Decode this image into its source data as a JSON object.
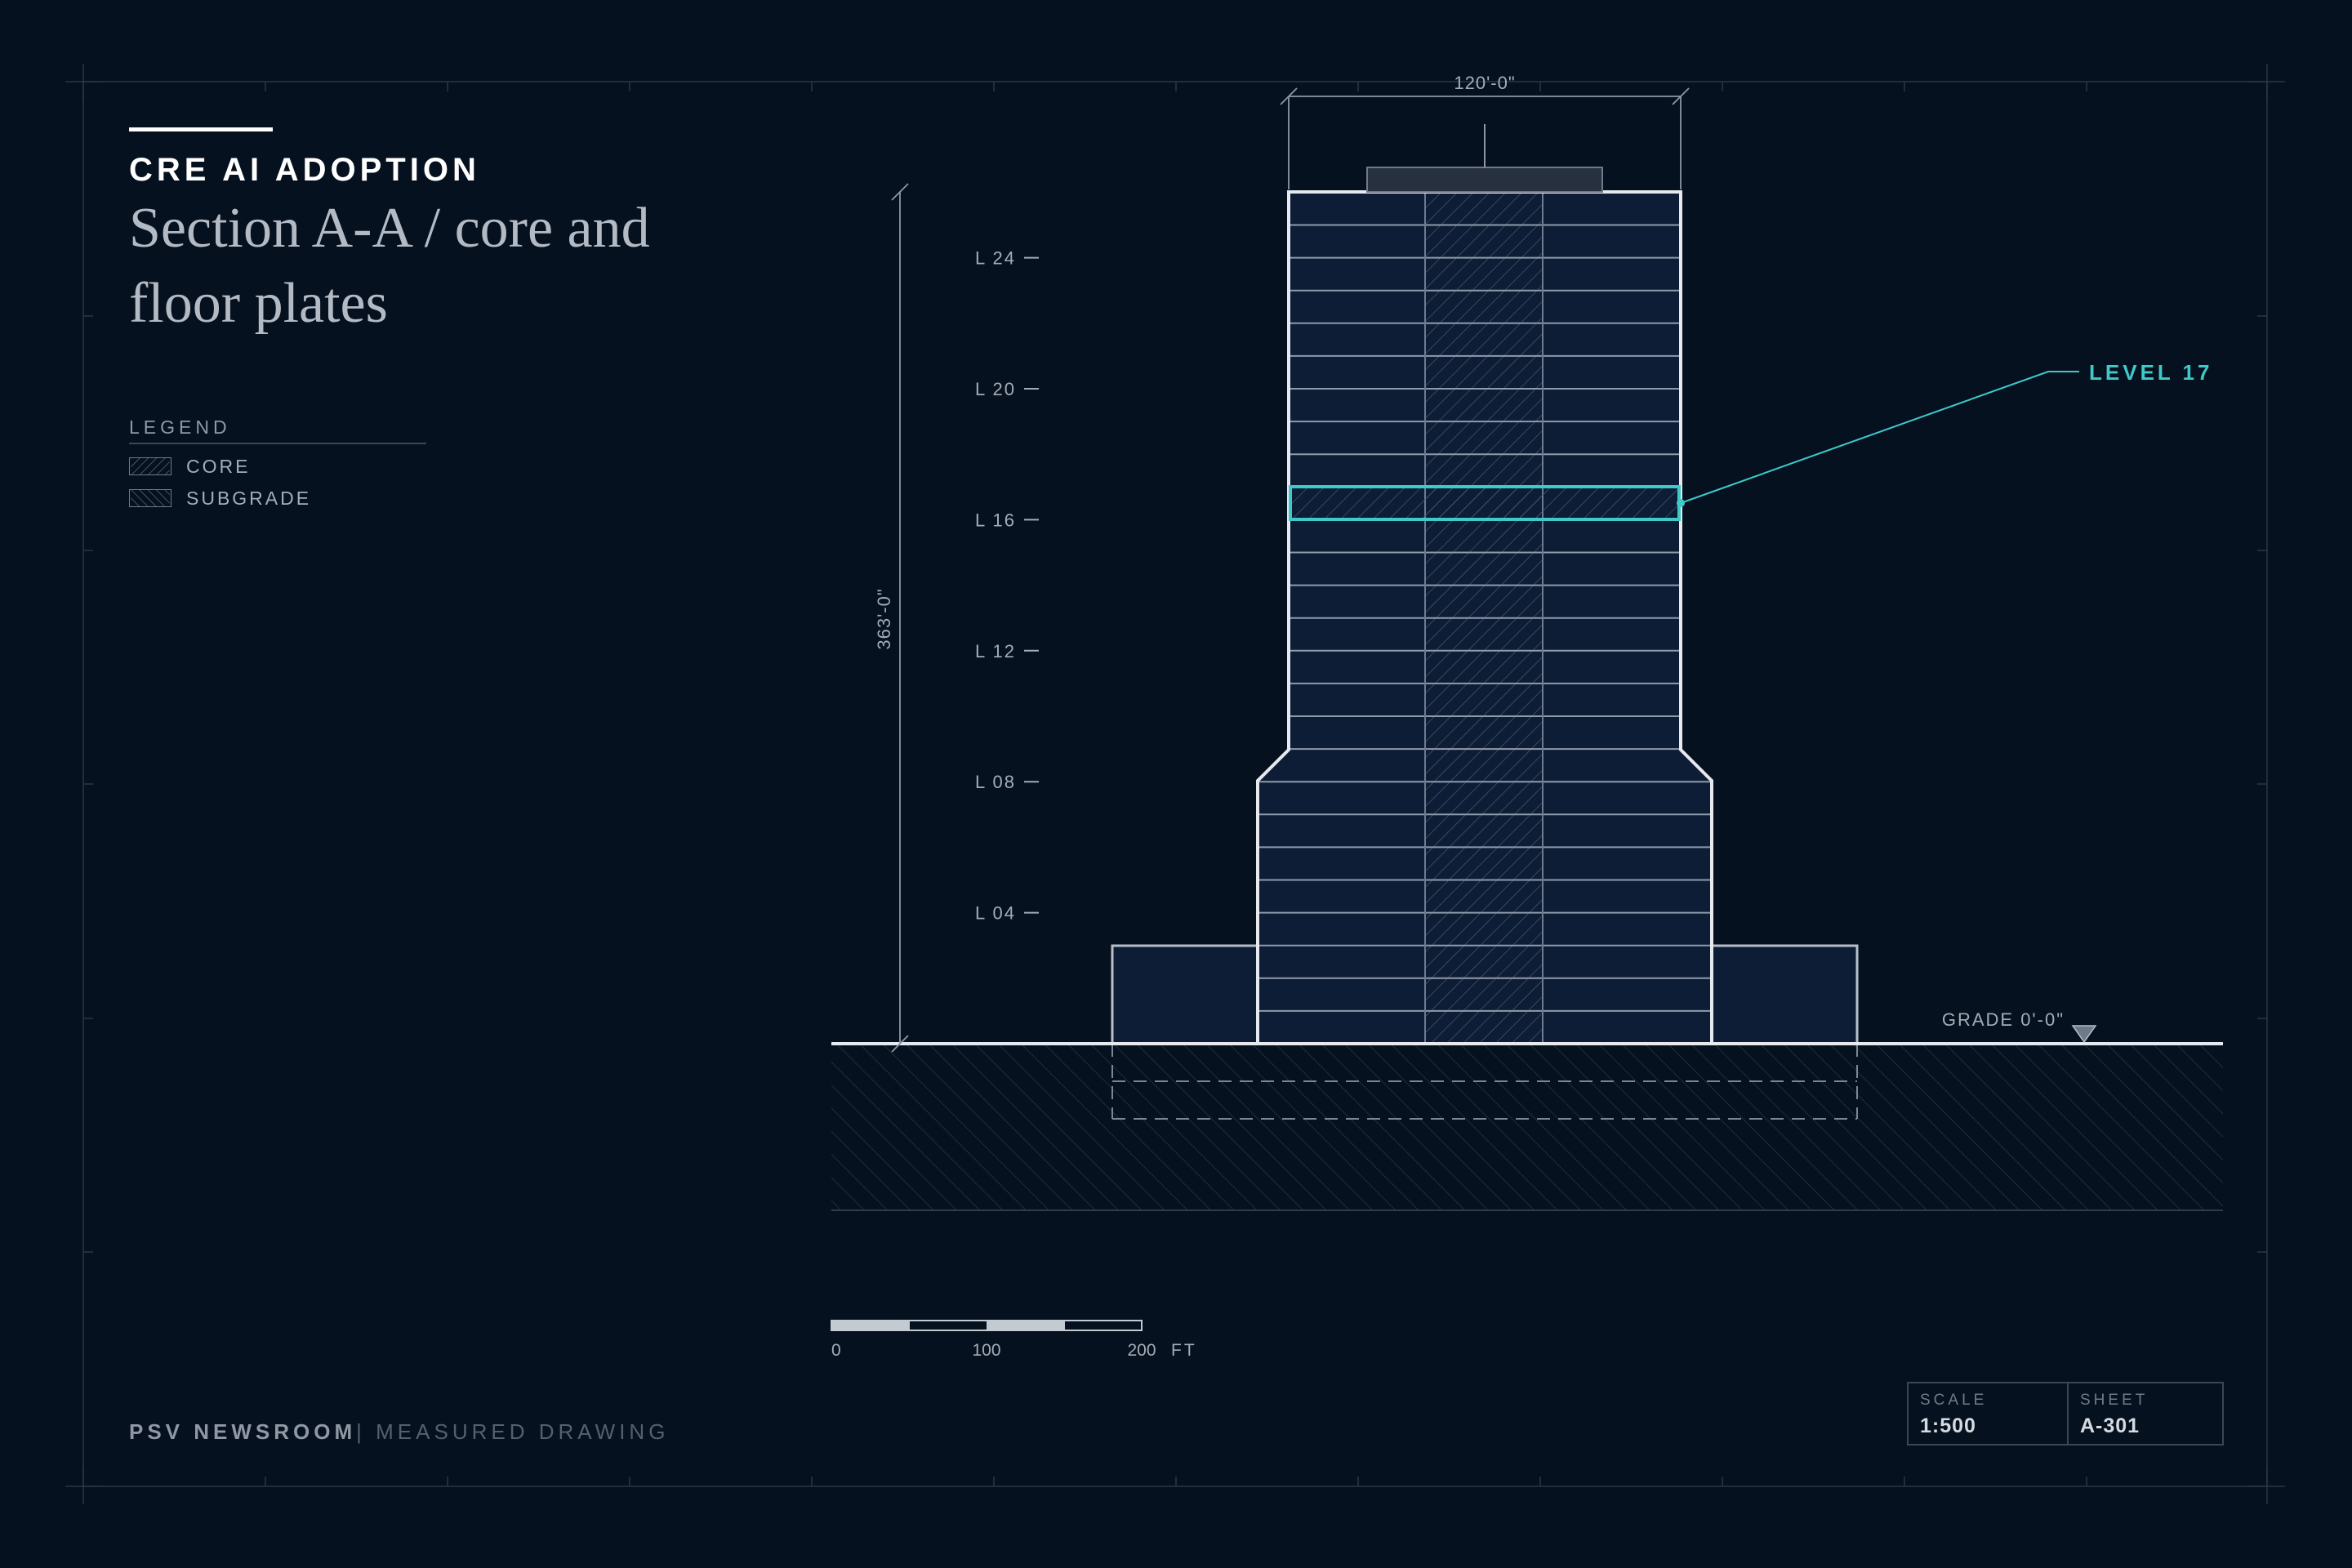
{
  "header": {
    "kicker": "CRE AI ADOPTION",
    "title": "Section A-A / core and floor plates"
  },
  "legend": {
    "title": "LEGEND",
    "items": [
      {
        "label": "CORE",
        "pattern": "hatch-back"
      },
      {
        "label": "SUBGRADE",
        "pattern": "hatch-forward"
      }
    ]
  },
  "drawing": {
    "width_dimension": "120'-0\"",
    "height_dimension": "363'-0\"",
    "level_labels": [
      "L 24",
      "L 20",
      "L 16",
      "L 12",
      "L 08",
      "L 04"
    ],
    "callout": "LEVEL 17",
    "grade_label": "GRADE 0'-0\"",
    "scale_bar": {
      "ticks": [
        "0",
        "100",
        "200"
      ],
      "unit": "FT"
    }
  },
  "footer": {
    "brand": "PSV NEWSROOM",
    "separator": "|",
    "subtitle": "MEASURED DRAWING"
  },
  "title_block": {
    "scale_label": "SCALE",
    "scale_value": "1:500",
    "sheet_label": "SHEET",
    "sheet_value": "A-301"
  },
  "colors": {
    "background": "#06111f",
    "line": "#e6e9ed",
    "accent": "#3fc9c9",
    "muted": "#8f98a4",
    "floor_fill": "#0e1d36"
  }
}
